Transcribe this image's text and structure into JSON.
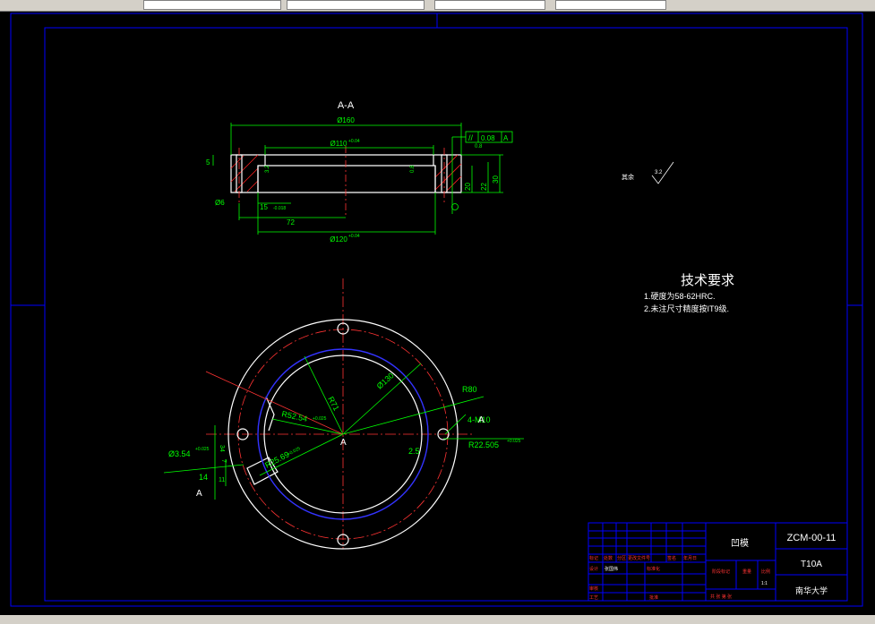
{
  "section_label": "A-A",
  "dims_section": {
    "d160": "Ø160",
    "d110": "Ø110",
    "d110_tol": "+0.04",
    "d120": "Ø120",
    "d120_tol": "+0.04",
    "d6": "Ø6",
    "w15": "15",
    "w15_tol": "-0.018",
    "w72": "72",
    "h5": "5",
    "h20": "20",
    "h22": "22",
    "h30": "30",
    "rough_inner": "3.2",
    "rough_side": "0.8",
    "rough_right": "0.8",
    "parallel_value": "0.08",
    "datum": "A",
    "rough_note_text": "其余",
    "rough_note_value": "3.2"
  },
  "tech": {
    "title": "技术要求",
    "line1": "1.硬度为58-62HRC.",
    "line2": "2.未注尺寸精度按IT9级."
  },
  "dims_plan": {
    "r71": "R71",
    "r80": "R80",
    "d130": "Ø130",
    "r52": "R52.54",
    "r52_tol": "+0.025",
    "r25": "R25.69",
    "r25_tol": "+0.025",
    "m10": "4-M10",
    "r22": "R22.505",
    "r22_tol": "+0.025",
    "d3": "Ø3.54",
    "d3_tol": "+0.025",
    "v25": "2.5",
    "v14": "14",
    "v11": "11",
    "v34": "34",
    "v7": "7",
    "center": "A",
    "sec_a_left": "A",
    "sec_a_right": "A"
  },
  "title_block": {
    "part_name": "凹模",
    "drawing_no": "ZCM-00-11",
    "material": "T10A",
    "school": "南华大学",
    "h_mark": "标记",
    "h_count": "处数",
    "h_zone": "分区",
    "h_doc": "更改文件号",
    "h_sign": "签名",
    "h_date": "年月日",
    "design": "设计",
    "designer": "张国伟",
    "standard": "标准化",
    "stage": "阶段标记",
    "weight": "重量",
    "ratio_label": "比例",
    "ratio": "1:1",
    "review": "审核",
    "process": "工艺",
    "approve": "批准",
    "sheets": "共  张 第  张"
  },
  "colors": {
    "outline": "#ffffff",
    "dimension": "#00ff00",
    "center_line": "#ff3333",
    "border": "#0000ff",
    "hatch": "#ff2020",
    "thread": "#3333ff",
    "note": "#00ffff",
    "text": "#ffffff"
  }
}
